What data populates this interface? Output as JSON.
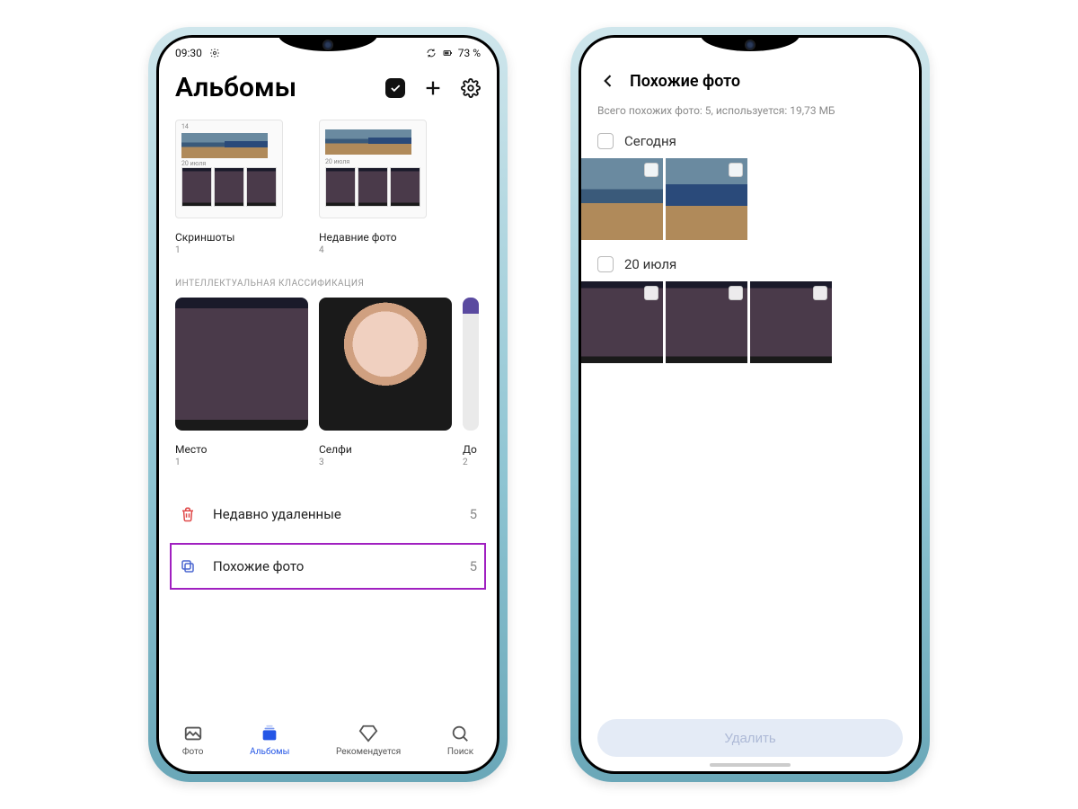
{
  "phone1": {
    "status": {
      "time": "09:30",
      "battery": "73 %"
    },
    "title": "Альбомы",
    "albums": [
      {
        "label": "Скриншоты",
        "count": "1"
      },
      {
        "label": "Недавние фото",
        "count": "4"
      }
    ],
    "section_label": "ИНТЕЛЛЕКТУАЛЬНАЯ КЛАССИФИКАЦИЯ",
    "smart": [
      {
        "label": "Место",
        "count": "1"
      },
      {
        "label": "Селфи",
        "count": "3"
      },
      {
        "label": "До",
        "count": "2"
      }
    ],
    "list": {
      "deleted": {
        "label": "Недавно удаленные",
        "count": "5"
      },
      "similar": {
        "label": "Похожие фото",
        "count": "5"
      }
    },
    "nav": {
      "photos": "Фото",
      "albums": "Альбомы",
      "recommend": "Рекомендуется",
      "search": "Поиск"
    },
    "mini_dates": {
      "d1": "14",
      "d2": "20 июля"
    }
  },
  "phone2": {
    "title": "Похожие фото",
    "subtitle": "Всего похожих фото: 5, используется: 19,73 МБ",
    "groups": [
      {
        "label": "Сегодня",
        "count": 2
      },
      {
        "label": "20 июля",
        "count": 3
      }
    ],
    "delete_label": "Удалить"
  }
}
